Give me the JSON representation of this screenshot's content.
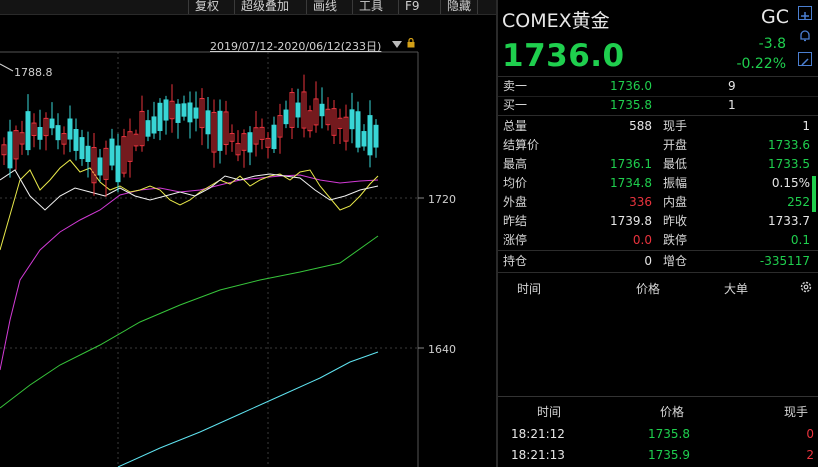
{
  "toolbar": {
    "items": [
      "复权",
      "超级叠加",
      "画线",
      "工具",
      "F9",
      "隐藏"
    ]
  },
  "chart": {
    "range_label": "2019/07/12-2020/06/12(233日)",
    "peak_label": "1788.8",
    "axis_labels": [
      "1720",
      "1640"
    ]
  },
  "quote": {
    "title": "COMEX黄金",
    "code": "GC",
    "price": "1736.0",
    "change": "-3.8",
    "change_pct": "-0.22%",
    "colors": {
      "up": "#e8333d",
      "down": "#1fcf4e",
      "neutral": "#e6e6e6"
    },
    "icons": [
      "plus-icon",
      "bell-icon",
      "edit-icon"
    ]
  },
  "book": [
    {
      "label": "卖一",
      "price": "1736.0",
      "vol": "9"
    },
    {
      "label": "买一",
      "price": "1735.8",
      "vol": "1"
    }
  ],
  "stats": [
    {
      "l1": "总量",
      "v1": "588",
      "c1": "white",
      "l2": "现手",
      "v2": "1",
      "c2": "white"
    },
    {
      "l1": "结算价",
      "v1": "",
      "c1": "white",
      "l2": "开盘",
      "v2": "1733.6",
      "c2": "green"
    },
    {
      "l1": "最高",
      "v1": "1736.1",
      "c1": "green",
      "l2": "最低",
      "v2": "1733.5",
      "c2": "green"
    },
    {
      "l1": "均价",
      "v1": "1734.8",
      "c1": "green",
      "l2": "振幅",
      "v2": "0.15%",
      "c2": "white"
    },
    {
      "l1": "外盘",
      "v1": "336",
      "c1": "red",
      "l2": "内盘",
      "v2": "252",
      "c2": "green"
    },
    {
      "l1": "昨结",
      "v1": "1739.8",
      "c1": "white",
      "l2": "昨收",
      "v2": "1733.7",
      "c2": "white"
    },
    {
      "l1": "涨停",
      "v1": "0.0",
      "c1": "red",
      "l2": "跌停",
      "v2": "0.1",
      "c2": "green"
    }
  ],
  "open_interest": {
    "l1": "持仓",
    "v1": "0",
    "l2": "增仓",
    "v2": "-335117"
  },
  "big_orders": {
    "headers": [
      "时间",
      "价格",
      "大单"
    ],
    "settings_icon": "gear-icon"
  },
  "trades": {
    "headers": [
      "时间",
      "价格",
      "现手"
    ],
    "rows": [
      {
        "time": "18:21:12",
        "price": "1735.8",
        "vol": "0"
      },
      {
        "time": "18:21:13",
        "price": "1735.9",
        "vol": "2"
      }
    ]
  }
}
